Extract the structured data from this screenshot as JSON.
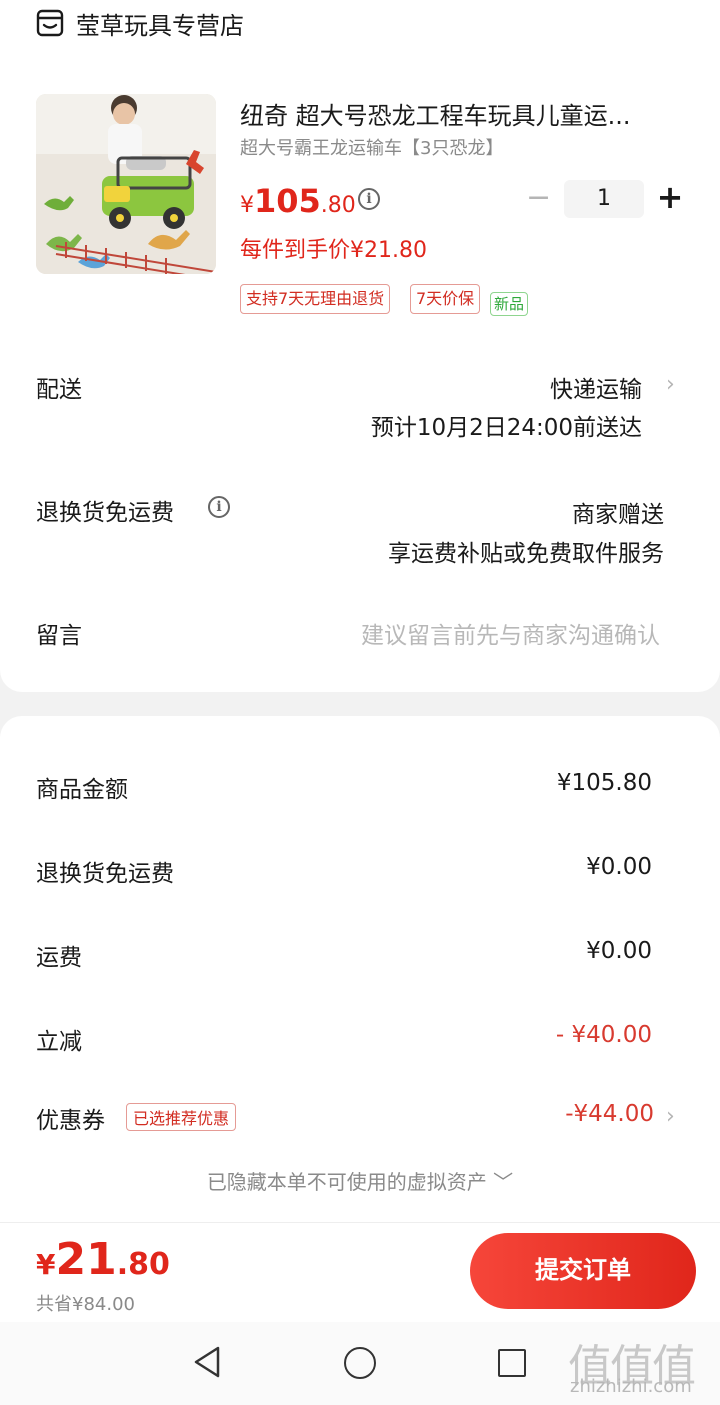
{
  "store": {
    "name": "莹草玩具专营店",
    "icon": "store-icon"
  },
  "product": {
    "title": "纽奇 超大号恐龙工程车玩具儿童运...",
    "spec": "超大号霸王龙运输车【3只恐龙】",
    "price_symbol": "¥",
    "price_int": "105",
    "price_dec": ".80",
    "quantity": "1",
    "unit_price": "每件到手价¥21.80",
    "tags": [
      "支持7天无理由退货",
      "7天价保",
      "新品"
    ]
  },
  "delivery": {
    "label": "配送",
    "method": "快递运输",
    "eta": "预计10月2日24:00前送达"
  },
  "return_shipping": {
    "label": "退换货免运费",
    "value": "商家赠送",
    "sub": "享运费补贴或免费取件服务"
  },
  "message": {
    "label": "留言",
    "placeholder": "建议留言前先与商家沟通确认"
  },
  "summary": {
    "goods_label": "商品金额",
    "goods_value": "¥105.80",
    "return_label": "退换货免运费",
    "return_value": "¥0.00",
    "shipping_label": "运费",
    "shipping_value": "¥0.00",
    "discount_label": "立减",
    "discount_value": "- ¥40.00",
    "coupon_label": "优惠券",
    "coupon_tag": "已选推荐优惠",
    "coupon_value": "-¥44.00",
    "hidden_note": "已隐藏本单不可使用的虚拟资产 ﹀"
  },
  "footer": {
    "total_symbol": "¥",
    "total_int": "21",
    "total_dec": ".80",
    "saved": "共省¥84.00",
    "submit_label": "提交订单"
  },
  "watermark": {
    "text": "值值值",
    "url": "zhizhizhi.com"
  },
  "colors": {
    "accent": "#e0261b",
    "tag_green": "#2fa83a",
    "muted": "#8a8a8a"
  }
}
